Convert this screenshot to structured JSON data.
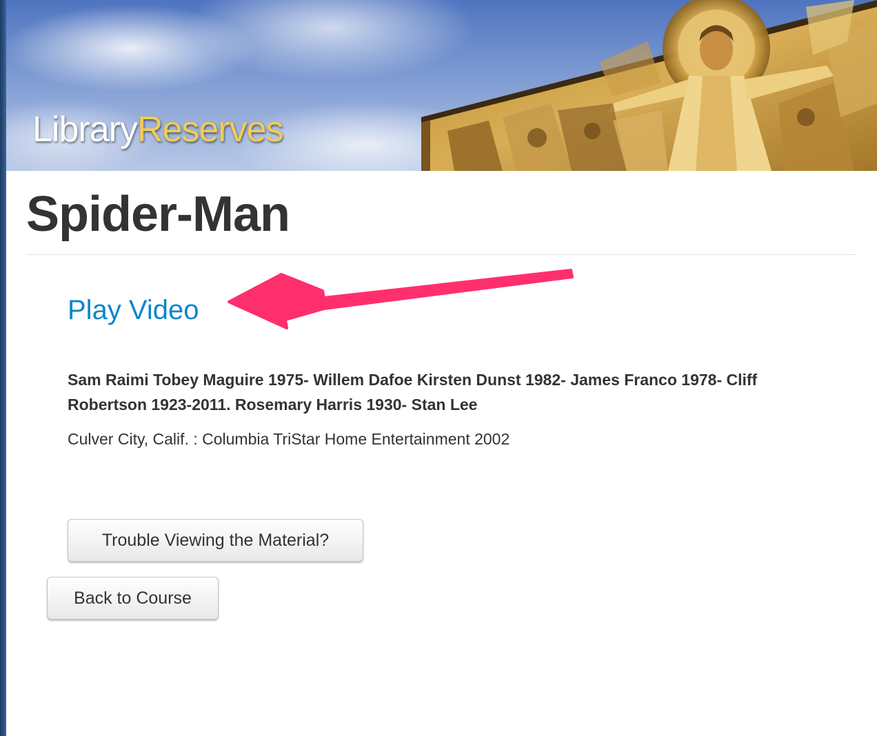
{
  "header": {
    "logo_part1": "Library",
    "logo_part2": "Reserves",
    "banner_image": "mural-of-christ-on-library-facade"
  },
  "item": {
    "title": "Spider-Man",
    "play_link_label": "Play Video",
    "credits": "Sam Raimi Tobey Maguire 1975- Willem Dafoe Kirsten Dunst 1982- James Franco 1978- Cliff Robertson 1923-2011. Rosemary Harris 1930- Stan Lee",
    "publisher": "Culver City, Calif. : Columbia TriStar Home Entertainment 2002"
  },
  "buttons": {
    "trouble_label": "Trouble Viewing the Material?",
    "back_label": "Back to Course"
  },
  "annotation": {
    "icon": "arrow-left-icon",
    "color": "#ff2f6e"
  },
  "colors": {
    "link": "#0d86cc",
    "text": "#333333",
    "logo_accent": "#f2cc55"
  }
}
